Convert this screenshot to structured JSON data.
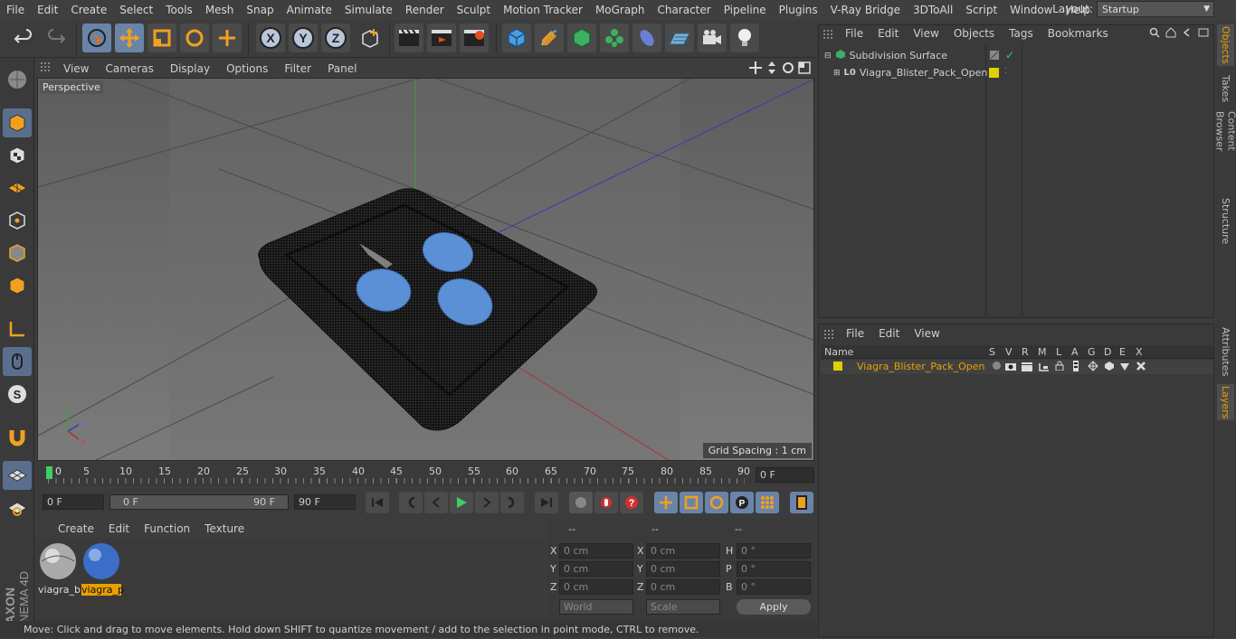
{
  "menubar": {
    "items": [
      "File",
      "Edit",
      "Create",
      "Select",
      "Tools",
      "Mesh",
      "Snap",
      "Animate",
      "Simulate",
      "Render",
      "Sculpt",
      "Motion Tracker",
      "MoGraph",
      "Character",
      "Pipeline",
      "Plugins",
      "V-Ray Bridge",
      "3DToAll",
      "Script",
      "Window",
      "Help"
    ],
    "layout_label": "Layout:",
    "layout_value": "Startup"
  },
  "toolbar": {
    "icons": [
      "undo-icon",
      "redo-icon",
      "live-selection-icon",
      "move-icon",
      "scale-icon",
      "rotate-icon",
      "move-transform-icon",
      "x-axis-icon",
      "y-axis-icon",
      "z-axis-icon",
      "world-coord-icon",
      "render-view-icon",
      "render-picture-queue-icon",
      "render-settings-icon",
      "cube-icon",
      "pen-icon",
      "subdivision-icon",
      "mograph-icon",
      "deformer-icon",
      "floor-icon",
      "camera-icon",
      "light-icon"
    ]
  },
  "viewport": {
    "menu": [
      "View",
      "Cameras",
      "Display",
      "Options",
      "Filter",
      "Panel"
    ],
    "label": "Perspective",
    "grid_spacing": "Grid Spacing : 1 cm"
  },
  "timeline": {
    "ticks": [
      "0",
      "5",
      "10",
      "15",
      "20",
      "25",
      "30",
      "35",
      "40",
      "45",
      "50",
      "55",
      "60",
      "65",
      "70",
      "75",
      "80",
      "85",
      "90"
    ],
    "current_frame": "0 F"
  },
  "transport": {
    "start_field": "0 F",
    "range_start": "0 F",
    "range_end": "90 F",
    "end_field": "90 F"
  },
  "materials": {
    "menu": [
      "Create",
      "Edit",
      "Function",
      "Texture"
    ],
    "items": [
      {
        "label": "viagra_b"
      },
      {
        "label": "viagra_p"
      }
    ]
  },
  "coords": {
    "headers": [
      "--",
      "--",
      "--"
    ],
    "rows": [
      {
        "a": "X",
        "av": "0 cm",
        "b": "X",
        "bv": "0 cm",
        "c": "H",
        "cv": "0 °"
      },
      {
        "a": "Y",
        "av": "0 cm",
        "b": "Y",
        "bv": "0 cm",
        "c": "P",
        "cv": "0 °"
      },
      {
        "a": "Z",
        "av": "0 cm",
        "b": "Z",
        "bv": "0 cm",
        "c": "B",
        "cv": "0 °"
      }
    ],
    "mode": "World",
    "transform": "Scale",
    "apply": "Apply"
  },
  "status": "Move: Click and drag to move elements. Hold down SHIFT to quantize movement / add to the selection in point mode, CTRL to remove.",
  "objects": {
    "menu": [
      "File",
      "Edit",
      "View",
      "Objects",
      "Tags",
      "Bookmarks"
    ],
    "items": [
      "Subdivision Surface",
      "Viagra_Blister_Pack_Open"
    ]
  },
  "layers": {
    "menu": [
      "File",
      "Edit",
      "View"
    ],
    "columns": [
      "Name",
      "S",
      "V",
      "R",
      "M",
      "L",
      "A",
      "G",
      "D",
      "E",
      "X"
    ],
    "items": [
      "Viagra_Blister_Pack_Open"
    ]
  },
  "sidetabs": [
    "Objects",
    "Takes",
    "Content Browser",
    "Structure",
    "Attributes",
    "Layers"
  ],
  "branding": {
    "maxon": "MAXON",
    "cinema": "CINEMA 4D"
  },
  "colors": {
    "accent": "#e8a000",
    "active_blue": "#6a84a8",
    "pill_blue": "#5b8fd6"
  }
}
